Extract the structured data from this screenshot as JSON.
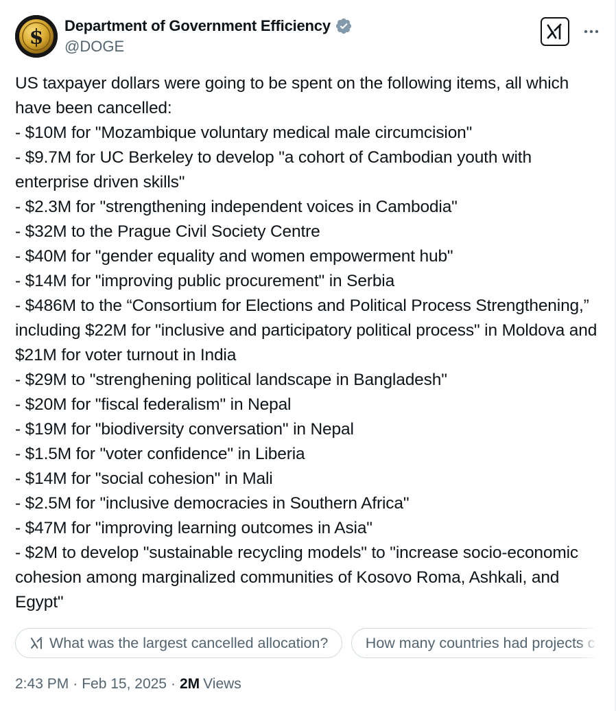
{
  "author": {
    "display_name": "Department of Government Efficiency",
    "handle": "@DOGE",
    "verified": true,
    "verified_color": "#829aab",
    "avatar_icon": "gold-dollar-coin-icon"
  },
  "actions": {
    "grok_icon": "grok-icon",
    "more_icon": "more-horizontal-icon"
  },
  "tweet": {
    "text": "US taxpayer dollars were going to be spent on the following items, all which have been cancelled:\n- $10M for \"Mozambique voluntary medical male circumcision\"\n- $9.7M for UC Berkeley to develop \"a cohort of Cambodian youth with enterprise driven skills\"\n- $2.3M for \"strengthening independent voices in Cambodia\"\n- $32M to the Prague Civil Society Centre\n- $40M for \"gender equality and women empowerment hub\"\n- $14M for \"improving public procurement\" in Serbia\n- $486M to the “Consortium for Elections and Political Process Strengthening,” including $22M for \"inclusive and participatory political process\" in Moldova and $21M for voter turnout in India\n- $29M to \"strenghening political landscape in Bangladesh\"\n- $20M for \"fiscal federalism\" in Nepal\n- $19M for \"biodiversity conversation\" in Nepal\n- $1.5M for \"voter confidence\" in Liberia\n- $14M for \"social cohesion\" in Mali\n- $2.5M for \"inclusive democracies in Southern Africa\"\n- $47M for \"improving learning outcomes in Asia\"\n- $2M to develop \"sustainable recycling models\" to \"increase socio-economic cohesion among marginalized communities of Kosovo Roma, Ashkali, and Egypt\""
  },
  "suggestions": [
    {
      "label": "What was the largest cancelled allocation?",
      "icon": "grok-icon"
    },
    {
      "label": "How many countries had projects cancelled?"
    }
  ],
  "meta": {
    "time": "2:43 PM",
    "separator": "·",
    "date": "Feb 15, 2025",
    "views_count": "2M",
    "views_label": "Views"
  }
}
